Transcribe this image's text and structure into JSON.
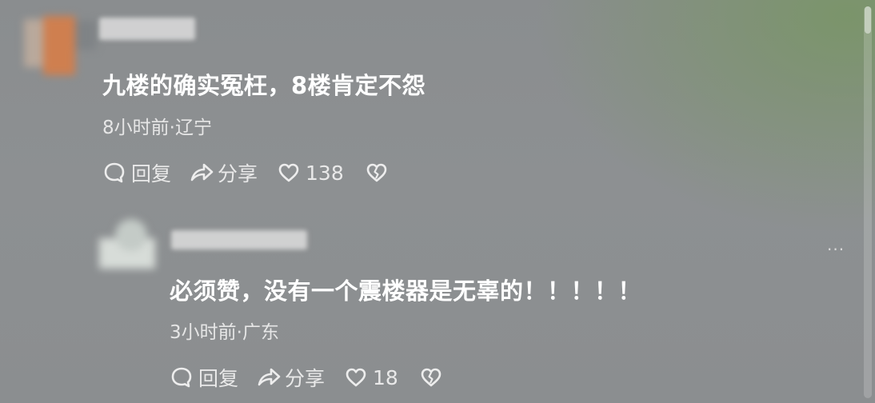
{
  "comments": [
    {
      "text": "九楼的确实冤枉，8楼肯定不怨",
      "meta": "8小时前·辽宁",
      "reply_label": "回复",
      "share_label": "分享",
      "like_count": "138"
    },
    {
      "text": "必须赞，没有一个震楼器是无辜的！！！！！",
      "meta": "3小时前·广东",
      "reply_label": "回复",
      "share_label": "分享",
      "like_count": "18",
      "more_label": "···"
    }
  ],
  "icons": {
    "reply": "reply-bubble-icon",
    "share": "share-arrow-icon",
    "like": "heart-icon",
    "dislike": "broken-heart-icon"
  }
}
